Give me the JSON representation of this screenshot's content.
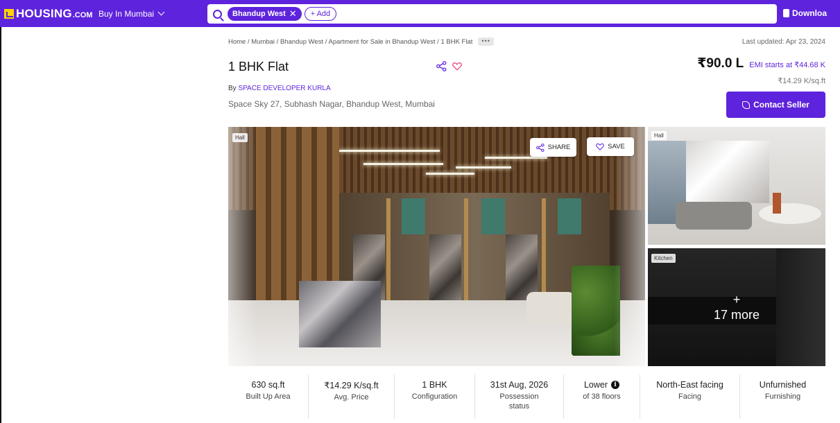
{
  "header": {
    "logo_text": "HOUSING",
    "logo_suffix": ".COM",
    "city_selector": "Buy In Mumbai",
    "search_chip": "Bhandup West",
    "add_chip": "+ Add",
    "download_label": "Downloa"
  },
  "breadcrumb": {
    "text": "Home / Mumbai / Bhandup West / Apartment for Sale in Bhandup West / 1 BHK Flat",
    "more": "•••"
  },
  "listing": {
    "last_updated": "Last updated: Apr 23, 2024",
    "title": "1 BHK Flat",
    "by_prefix": "By",
    "developer": "SPACE DEVELOPER KURLA",
    "address": "Space Sky 27, Subhash Nagar, Bhandup West, Mumbai",
    "price": "₹90.0 L",
    "emi": "EMI starts at ₹44.68 K",
    "price_per_sqft": "₹14.29 K/sq.ft",
    "contact_label": "Contact Seller"
  },
  "gallery": {
    "main_tag": "Hall",
    "share_label": "SHARE",
    "save_label": "SAVE",
    "thumb1_tag": "Hall",
    "thumb2_tag": "Kitchen",
    "more_plus": "+",
    "more_label": "17 more"
  },
  "stats": [
    {
      "value": "630 sq.ft",
      "label": "Built Up Area"
    },
    {
      "value": "₹14.29 K/sq.ft",
      "label": "Avg. Price"
    },
    {
      "value": "1 BHK",
      "label": "Configuration"
    },
    {
      "value": "31st Aug, 2026",
      "label": "Possession status"
    },
    {
      "value": "Lower",
      "label": "of 38 floors"
    },
    {
      "value": "North-East facing",
      "label": "Facing"
    },
    {
      "value": "Unfurnished",
      "label": "Furnishing"
    }
  ],
  "colors": {
    "brand": "#5e23dc",
    "logo_accent": "#ffd400"
  }
}
